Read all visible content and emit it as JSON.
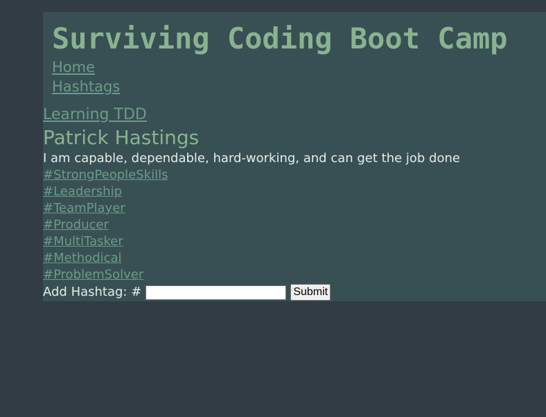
{
  "header": {
    "title": "Surviving Coding Boot Camp",
    "nav": [
      {
        "label": "Home"
      },
      {
        "label": "Hashtags"
      }
    ]
  },
  "post": {
    "link_label": "Learning TDD",
    "author": "Patrick Hastings",
    "bio": "I am capable, dependable, hard-working, and can get the job done"
  },
  "hashtags": [
    "#StrongPeopleSkills",
    "#Leadership",
    "#TeamPlayer",
    "#Producer",
    "#MultiTasker",
    "#Methodical",
    "#ProblemSolver"
  ],
  "form": {
    "label": "Add Hashtag: #",
    "input_value": "",
    "submit_label": "Submit"
  },
  "colors": {
    "page_background": "#313c44",
    "panel_background": "#385054",
    "title": "#89b38f",
    "link": "#6d9a88",
    "text": "#e6ece7"
  }
}
